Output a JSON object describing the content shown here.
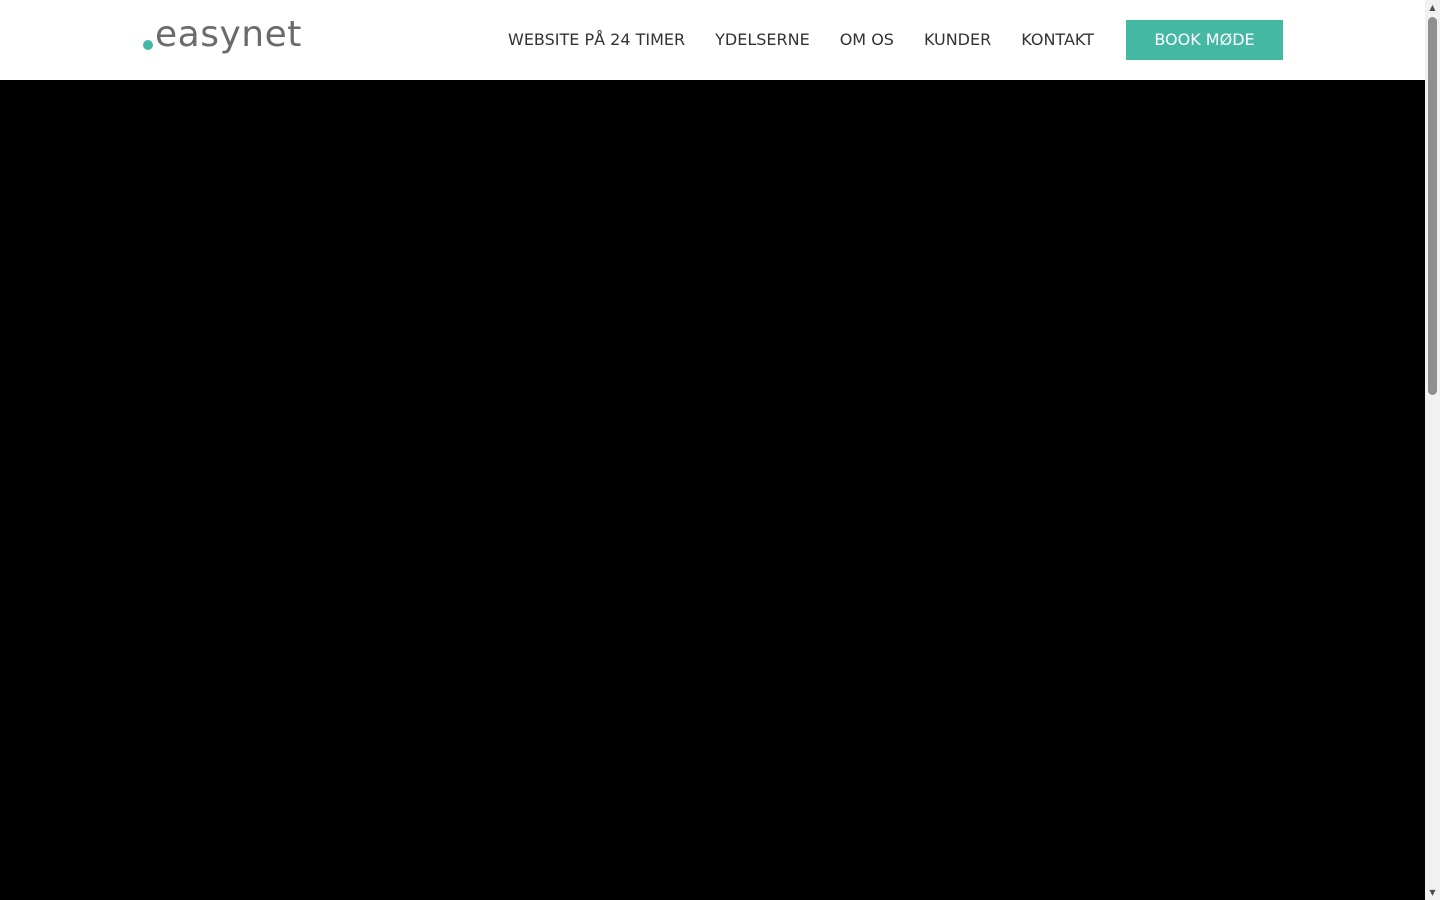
{
  "header": {
    "logo_text": "easynet",
    "nav": [
      {
        "label": "WEBSITE PÅ 24 TIMER"
      },
      {
        "label": "YDELSERNE"
      },
      {
        "label": "OM OS"
      },
      {
        "label": "KUNDER"
      },
      {
        "label": "KONTAKT"
      }
    ],
    "cta_label": "BOOK MØDE"
  },
  "colors": {
    "accent": "#45b8a3",
    "hero_background": "#000000",
    "logo_text": "#6b6b6b",
    "nav_text": "#333333"
  },
  "scrollbar": {
    "up_icon": "arrow-up-icon",
    "down_icon": "arrow-down-icon"
  }
}
